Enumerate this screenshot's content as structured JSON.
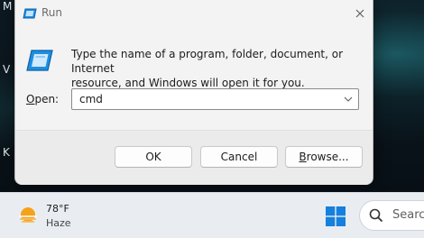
{
  "desktop": {
    "edge_letters": [
      "M",
      "V",
      "K"
    ]
  },
  "run_dialog": {
    "title": "Run",
    "description_line1": "Type the name of a program, folder, document, or Internet",
    "description_line2": "resource, and Windows will open it for you.",
    "open_label_accesskey": "O",
    "open_label_rest": "pen:",
    "open_value": "cmd",
    "ok_label": "OK",
    "cancel_label": "Cancel",
    "browse_accesskey": "B",
    "browse_rest": "rowse...",
    "icons": {
      "title": "run-icon",
      "body": "run-icon",
      "close": "close-icon",
      "dropdown": "chevron-down-icon"
    }
  },
  "taskbar": {
    "weather_temp": "78°F",
    "weather_condition": "Haze",
    "search_placeholder": "Search",
    "icons": {
      "weather": "sun-haze-icon",
      "start": "windows-logo-icon",
      "search": "search-icon"
    }
  },
  "colors": {
    "accent": "#0a6cc8",
    "dialog_bg": "#f3f3f3",
    "taskbar_bg": "#e9edf2"
  }
}
